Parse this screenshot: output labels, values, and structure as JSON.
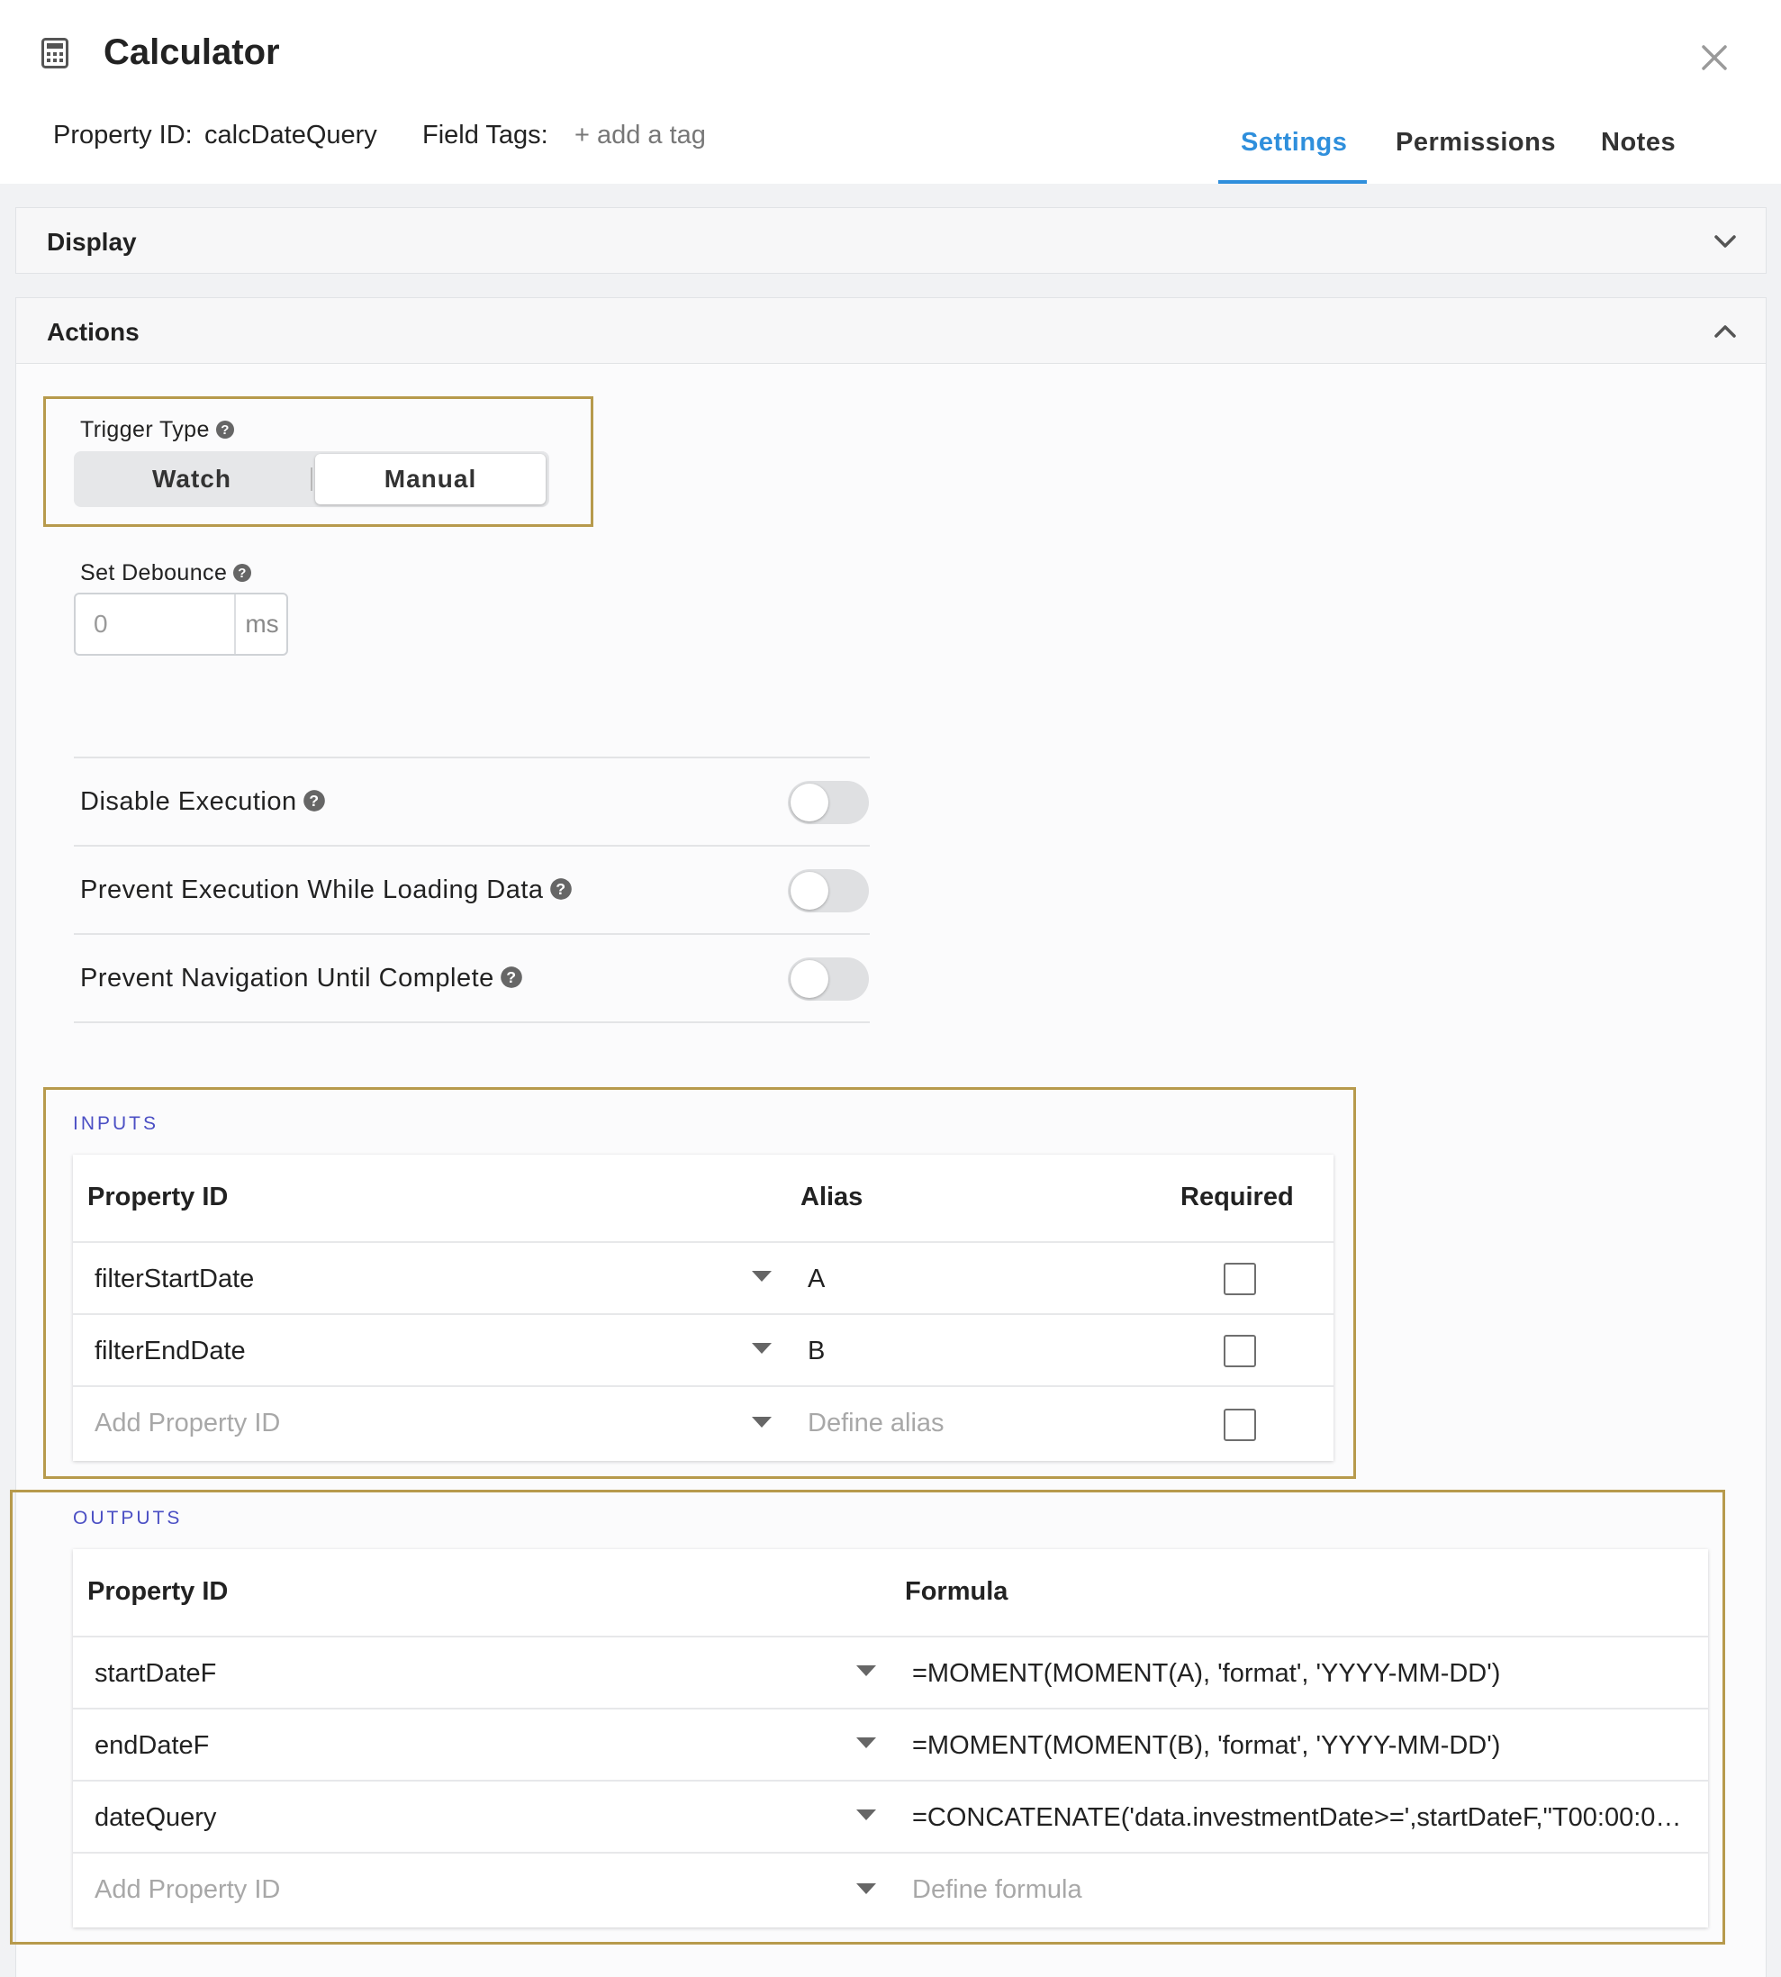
{
  "dialog": {
    "title": "Calculator",
    "icon": "calculator-icon",
    "property_id_label": "Property ID:",
    "property_id_value": "calcDateQuery",
    "field_tags_label": "Field Tags:",
    "add_tag_label": "+ add a tag",
    "close_icon": "close-icon"
  },
  "tabs": [
    {
      "label": "Settings",
      "active": true
    },
    {
      "label": "Permissions",
      "active": false
    },
    {
      "label": "Notes",
      "active": false
    }
  ],
  "panels": {
    "display": {
      "label": "Display",
      "expanded": false
    },
    "actions": {
      "label": "Actions",
      "expanded": true
    }
  },
  "trigger": {
    "label": "Trigger Type",
    "options": [
      "Watch",
      "Manual"
    ],
    "selected": "Manual"
  },
  "debounce": {
    "label": "Set Debounce",
    "placeholder": "0",
    "unit": "ms"
  },
  "toggles": [
    {
      "label": "Disable Execution",
      "on": false
    },
    {
      "label": "Prevent Execution While Loading Data",
      "on": false
    },
    {
      "label": "Prevent Navigation Until Complete",
      "on": false
    }
  ],
  "inputs": {
    "section_title": "INPUTS",
    "headers": {
      "property_id": "Property ID",
      "alias": "Alias",
      "required": "Required"
    },
    "rows": [
      {
        "property_id": "filterStartDate",
        "alias": "A",
        "required": false
      },
      {
        "property_id": "filterEndDate",
        "alias": "B",
        "required": false
      }
    ],
    "new_row": {
      "property_placeholder": "Add Property ID",
      "alias_placeholder": "Define alias"
    }
  },
  "outputs": {
    "section_title": "OUTPUTS",
    "headers": {
      "property_id": "Property ID",
      "formula": "Formula"
    },
    "rows": [
      {
        "property_id": "startDateF",
        "formula": "=MOMENT(MOMENT(A), 'format', 'YYYY-MM-DD')"
      },
      {
        "property_id": "endDateF",
        "formula": "=MOMENT(MOMENT(B), 'format', 'YYYY-MM-DD')"
      },
      {
        "property_id": "dateQuery",
        "formula": "=CONCATENATE('data.investmentDate>=',startDateF,\"T00:00:00.0…"
      }
    ],
    "new_row": {
      "property_placeholder": "Add Property ID",
      "formula_placeholder": "Define formula"
    }
  },
  "colors": {
    "accent": "#2f8fdc",
    "highlight_border": "#b79a4c",
    "section_title": "#4b4fc4"
  }
}
